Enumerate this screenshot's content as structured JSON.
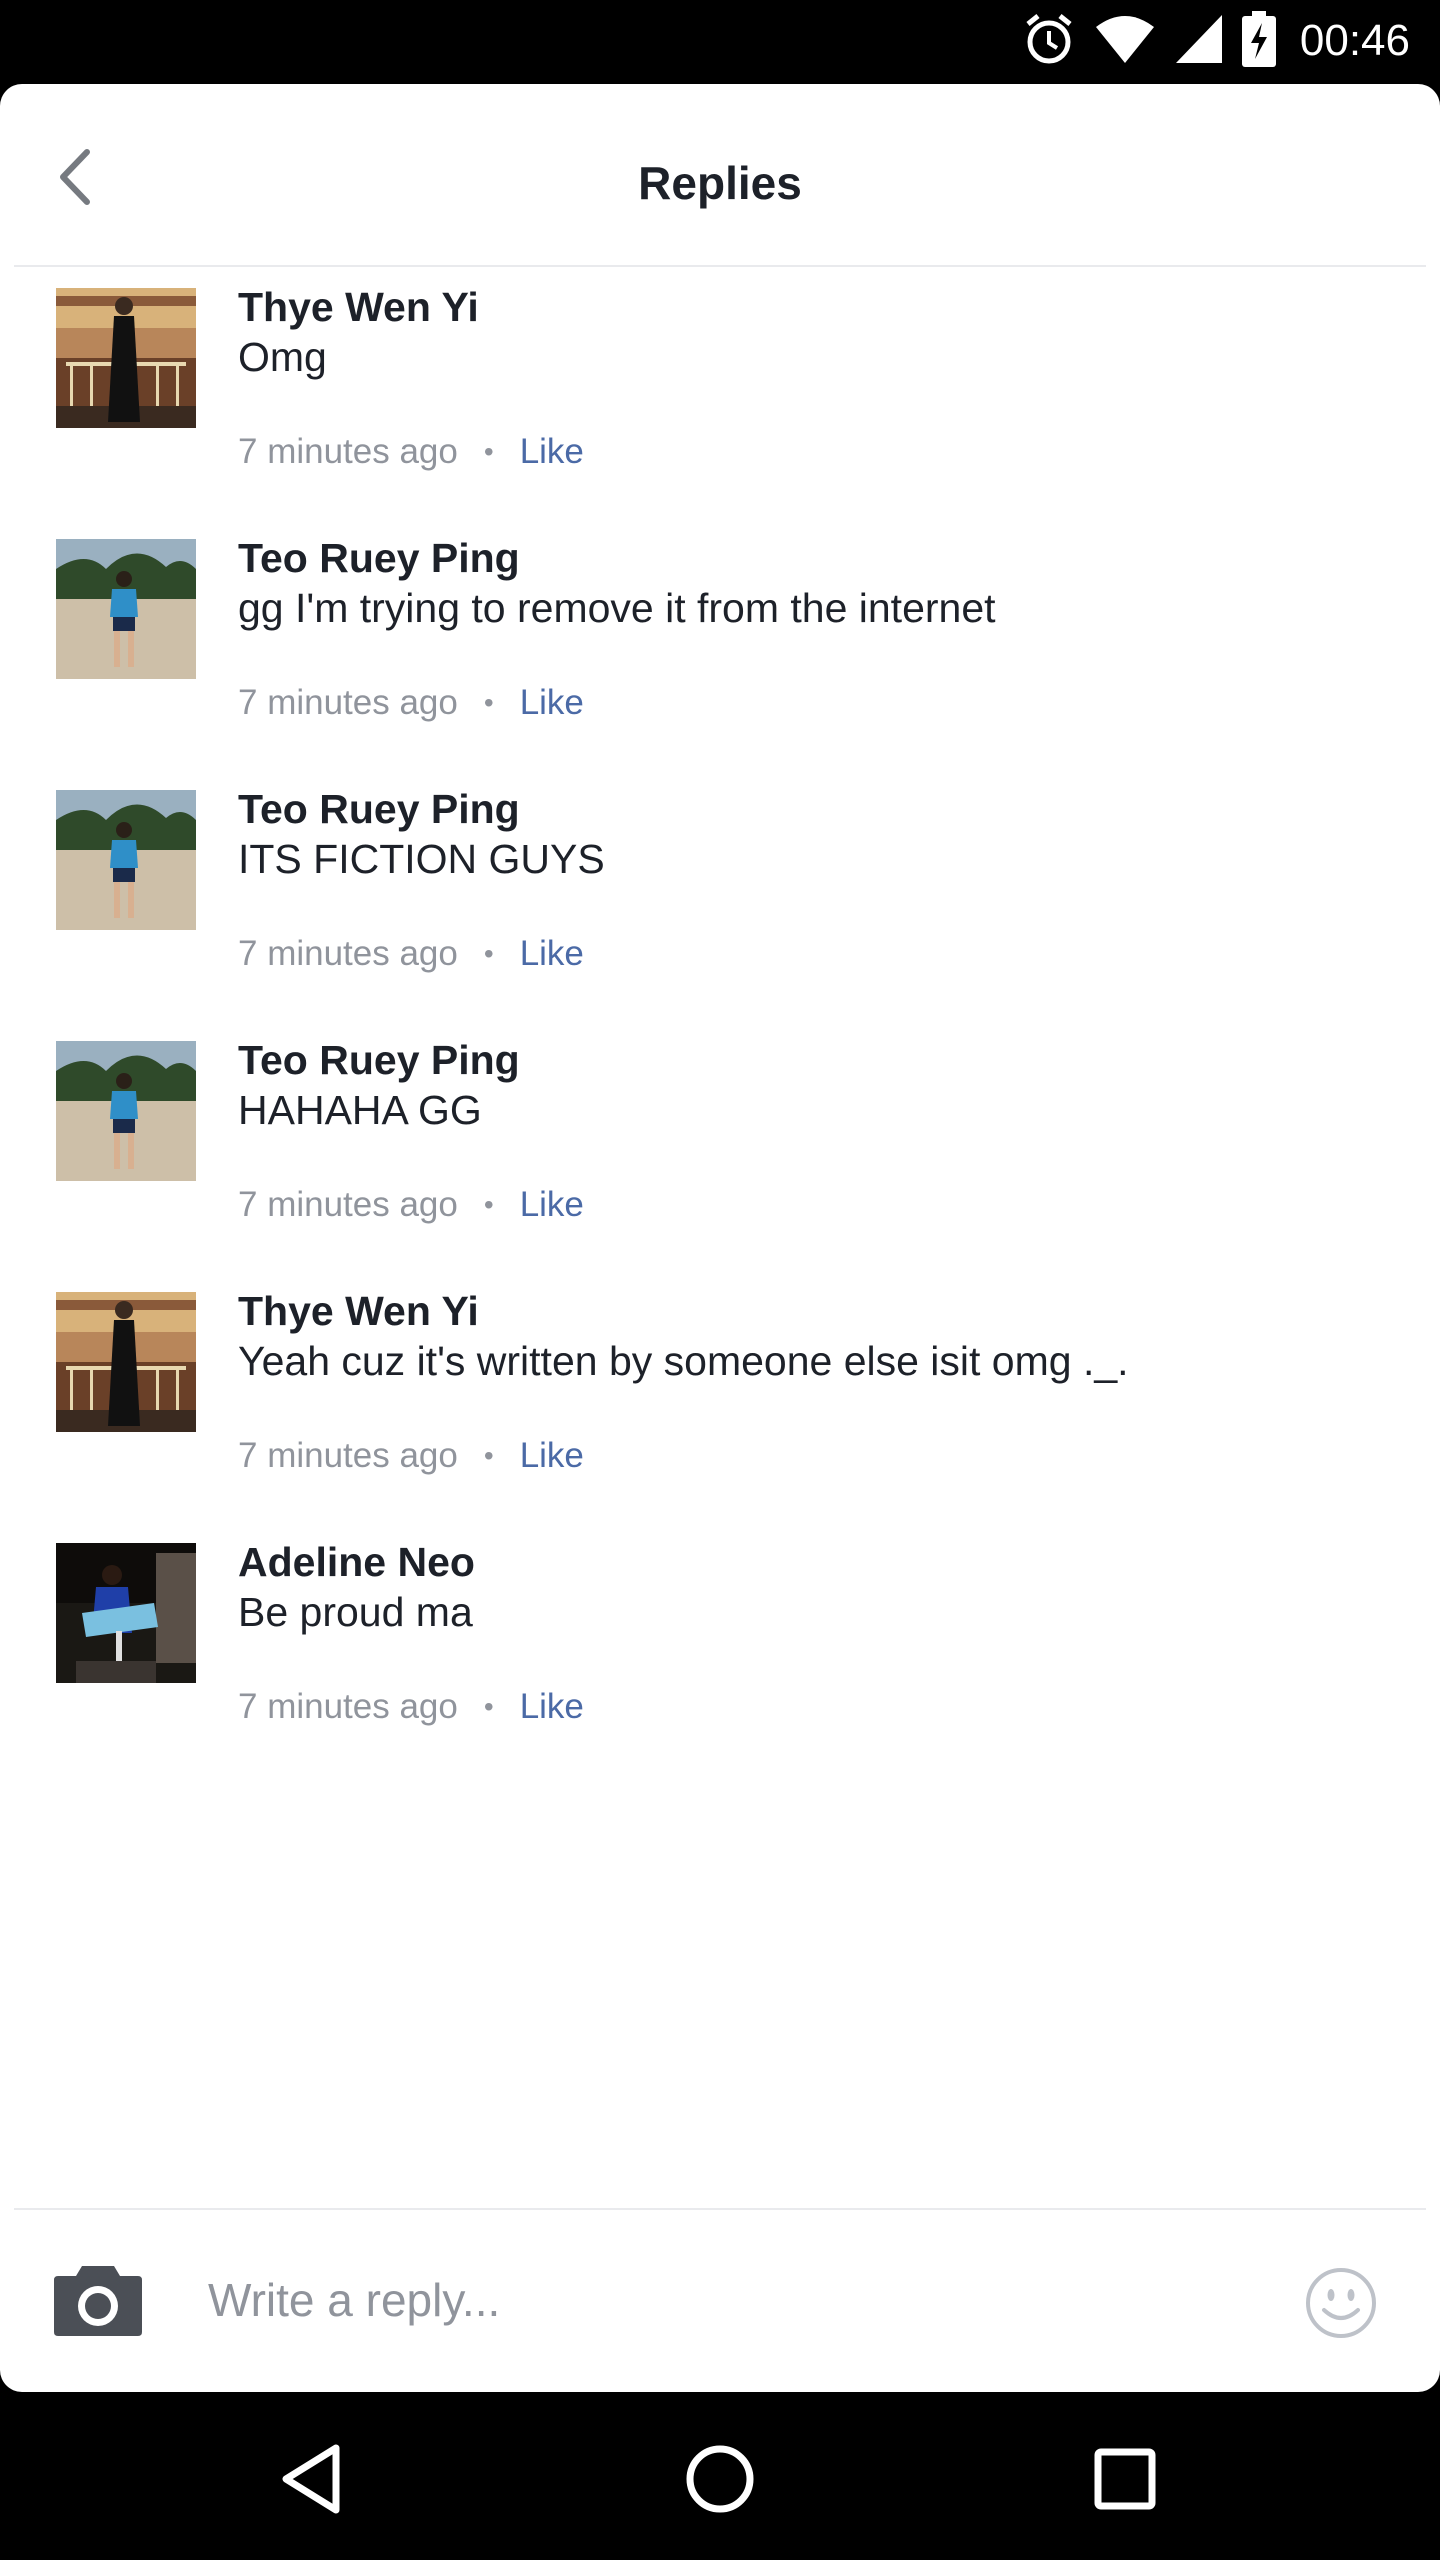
{
  "status_bar": {
    "time": "00:46",
    "icons": [
      "alarm-icon",
      "wifi-icon",
      "cell-signal-icon",
      "battery-charging-icon"
    ]
  },
  "header": {
    "title": "Replies",
    "back_icon": "chevron-left-icon"
  },
  "replies": [
    {
      "name": "Thye Wen Yi",
      "text": "Omg",
      "time": "7 minutes ago",
      "separator": "•",
      "like_label": "Like"
    },
    {
      "name": "Teo Ruey Ping",
      "text": "gg I'm trying to remove it from the internet",
      "time": "7 minutes ago",
      "separator": "•",
      "like_label": "Like"
    },
    {
      "name": "Teo Ruey Ping",
      "text": "ITS FICTION GUYS",
      "time": "7 minutes ago",
      "separator": "•",
      "like_label": "Like"
    },
    {
      "name": "Teo Ruey Ping",
      "text": "HAHAHA GG",
      "time": "7 minutes ago",
      "separator": "•",
      "like_label": "Like"
    },
    {
      "name": "Thye Wen Yi",
      "text": "Yeah cuz it's written by someone else isit omg ._.",
      "time": "7 minutes ago",
      "separator": "•",
      "like_label": "Like"
    },
    {
      "name": "Adeline Neo",
      "text": "Be proud ma",
      "time": "7 minutes ago",
      "separator": "•",
      "like_label": "Like"
    }
  ],
  "composer": {
    "placeholder": "Write a reply...",
    "camera_icon": "camera-icon",
    "emoji_icon": "smiley-icon"
  },
  "nav_bar": {
    "icons": [
      "back-triangle-icon",
      "home-circle-icon",
      "recents-square-icon"
    ]
  },
  "colors": {
    "text_primary": "#1d2129",
    "text_secondary": "#90949c",
    "link": "#4b6aa6",
    "divider": "#e9eaed"
  }
}
